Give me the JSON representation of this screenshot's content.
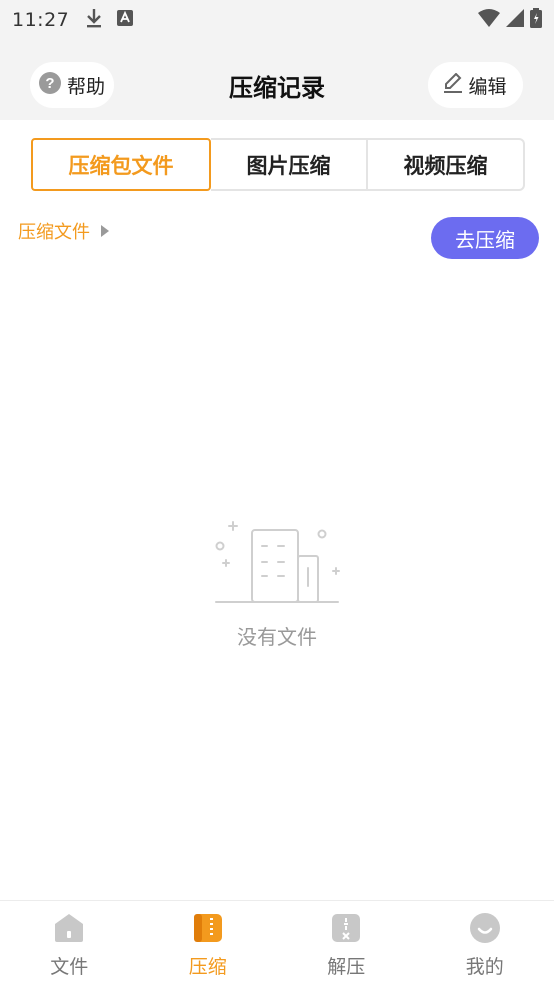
{
  "status_bar": {
    "time": "11:27"
  },
  "header": {
    "title": "压缩记录",
    "help_label": "帮助",
    "edit_label": "编辑"
  },
  "tabs": [
    {
      "label": "压缩包文件",
      "active": true
    },
    {
      "label": "图片压缩",
      "active": false
    },
    {
      "label": "视频压缩",
      "active": false
    }
  ],
  "breadcrumb": {
    "label": "压缩文件"
  },
  "go_compress_label": "去压缩",
  "empty_state": {
    "text": "没有文件"
  },
  "bottom_nav": [
    {
      "label": "文件",
      "icon": "home-icon",
      "active": false
    },
    {
      "label": "压缩",
      "icon": "compress-icon",
      "active": true
    },
    {
      "label": "解压",
      "icon": "unzip-icon",
      "active": false
    },
    {
      "label": "我的",
      "icon": "profile-icon",
      "active": false
    }
  ],
  "colors": {
    "accent": "#f39a1e",
    "primary_button": "#6c6cf0",
    "header_bg": "#f3f3f3"
  }
}
